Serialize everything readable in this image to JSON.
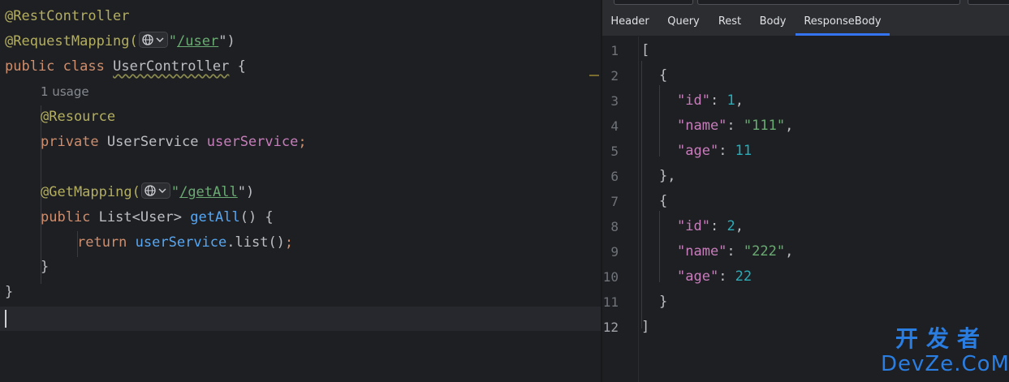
{
  "editor": {
    "lines": {
      "l1": {
        "ann": "@RestController"
      },
      "l2": {
        "ann": "@RequestMapping(",
        "quote_open": "\"",
        "path": "/user",
        "close": "\")"
      },
      "l3": {
        "kw1": "public",
        "kw2": "class",
        "name": "UserController",
        "brace": "{"
      },
      "l4": {
        "usage": "1 usage"
      },
      "l5": {
        "ann": "@Resource"
      },
      "l6": {
        "kw": "private",
        "type": "UserService",
        "field": "userService",
        "semi": ";"
      },
      "l7": {
        "ann": "@GetMapping(",
        "quote_open": "\"",
        "path": "/getAll",
        "close": "\")"
      },
      "l8": {
        "kw": "public",
        "type": "List<User>",
        "fn": "getAll",
        "rest": "() {"
      },
      "l9": {
        "kw": "return",
        "field": "userService",
        "call": ".list()",
        "semi": ";"
      },
      "l10": {
        "text": "}"
      },
      "l11": {
        "text": "}"
      }
    }
  },
  "panel": {
    "tabs": [
      {
        "label": "Header"
      },
      {
        "label": "Query"
      },
      {
        "label": "Rest"
      },
      {
        "label": "Body"
      },
      {
        "label": "ResponseBody"
      }
    ],
    "active_tab": "ResponseBody",
    "gutter": [
      "1",
      "2",
      "3",
      "4",
      "5",
      "6",
      "7",
      "8",
      "9",
      "10",
      "11",
      "12"
    ],
    "json": {
      "open_bracket": "[",
      "obj_open": "{",
      "obj_close_comma": "},",
      "obj_close": "}",
      "close_bracket": "]",
      "records": [
        {
          "id_key": "\"id\"",
          "id_val": "1",
          "name_key": "\"name\"",
          "name_val": "\"111\"",
          "age_key": "\"age\"",
          "age_val": "11"
        },
        {
          "id_key": "\"id\"",
          "id_val": "2",
          "name_key": "\"name\"",
          "name_val": "\"222\"",
          "age_key": "\"age\"",
          "age_val": "22"
        }
      ]
    }
  },
  "watermark": {
    "cn": "开发者",
    "en": "DevZe.CoM"
  },
  "colors": {
    "annotation": "#b3ae60",
    "keyword": "#cf8e6d",
    "string": "#6aab73",
    "field": "#c77dbb",
    "number": "#2aacb8",
    "accent_tab": "#3574f0",
    "watermark": "#2a7de1"
  },
  "icons": {
    "globe": "globe-icon",
    "chevron": "chevron-down-icon"
  }
}
